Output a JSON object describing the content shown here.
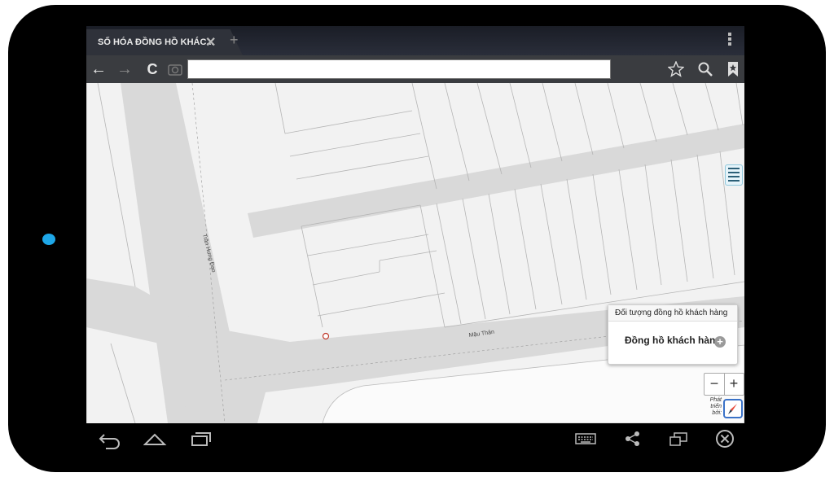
{
  "browser": {
    "tab_title": "SỐ HÓA ĐỒNG HỒ KHÁC...",
    "tab_close": "✕",
    "new_tab": "+",
    "nav": {
      "back": "←",
      "forward": "→",
      "reload": "C"
    },
    "icons": {
      "bookmark": "bookmark-star-icon",
      "search": "search-icon",
      "bookmarks": "bookmarks-icon",
      "menu": "overflow-menu-icon"
    }
  },
  "map": {
    "streets": [
      "Trần Hưng Đạo",
      "Mậu Thân"
    ]
  },
  "popup": {
    "title": "Đối tượng đồng hồ khách hàng",
    "item": "Đồng hồ khách hàng"
  },
  "controls": {
    "zoom_out": "−",
    "zoom_in": "+",
    "developed_by": "Phát triển bởi:"
  },
  "colors": {
    "camera": "#1ea7e8",
    "compass": "#3a72c8",
    "road": "#d9d9d9"
  }
}
